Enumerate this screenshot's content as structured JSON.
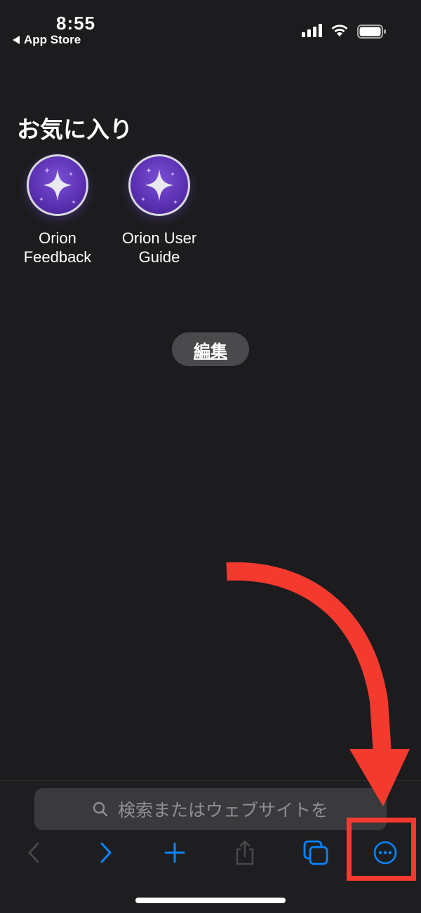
{
  "status_bar": {
    "time": "8:55",
    "back_app": "App Store"
  },
  "favorites": {
    "title": "お気に入り",
    "items": [
      {
        "label": "Orion\nFeedback",
        "icon": "orion-sparkle-icon"
      },
      {
        "label": "Orion User\nGuide",
        "icon": "orion-sparkle-icon"
      }
    ]
  },
  "edit_button": {
    "label": "編集"
  },
  "search": {
    "placeholder": "検索またはウェブサイトを"
  },
  "toolbar": {
    "back": "chevron-left-icon",
    "forward": "chevron-right-icon",
    "new_tab": "plus-icon",
    "share": "share-icon",
    "tabs": "tabs-icon",
    "more": "ellipsis-circle-icon"
  },
  "colors": {
    "background": "#1c1c1e",
    "accent": "#0a84ff",
    "annotation": "#f43a2f",
    "favicon_purple": "#5a2fb0"
  }
}
